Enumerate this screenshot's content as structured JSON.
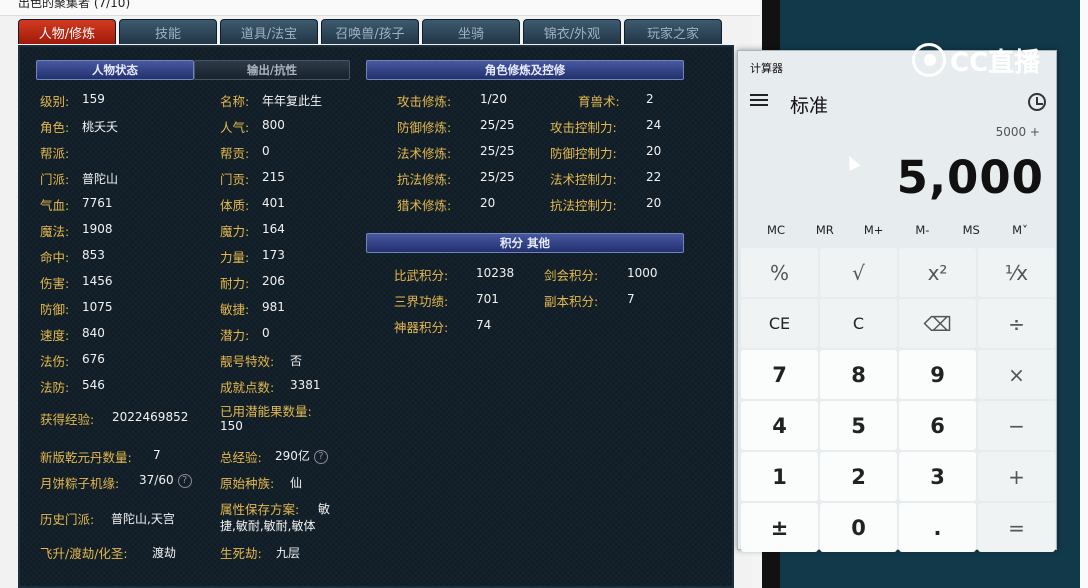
{
  "topbar_text": "出色的聚集者 (7/10)",
  "tabs": [
    "人物/修炼",
    "技能",
    "道具/法宝",
    "召唤兽/孩子",
    "坐骑",
    "锦衣/外观",
    "玩家之家"
  ],
  "panel_headers": {
    "char_status": "人物状态",
    "output_resist": "输出/抗性",
    "cultivation": "角色修炼及控修",
    "points": "积分 其他"
  },
  "left_stats": [
    {
      "label": "级别:",
      "value": "159"
    },
    {
      "label": "角色:",
      "value": "桃夭夭"
    },
    {
      "label": "帮派:",
      "value": ""
    },
    {
      "label": "门派:",
      "value": "普陀山"
    },
    {
      "label": "气血:",
      "value": "7761"
    },
    {
      "label": "魔法:",
      "value": "1908"
    },
    {
      "label": "命中:",
      "value": "853"
    },
    {
      "label": "伤害:",
      "value": "1456"
    },
    {
      "label": "防御:",
      "value": "1075"
    },
    {
      "label": "速度:",
      "value": "840"
    },
    {
      "label": "法伤:",
      "value": "676"
    },
    {
      "label": "法防:",
      "value": "546"
    }
  ],
  "right_stats": [
    {
      "label": "名称:",
      "value": "年年复此生"
    },
    {
      "label": "人气:",
      "value": "800"
    },
    {
      "label": "帮贡:",
      "value": "0"
    },
    {
      "label": "门贡:",
      "value": "215"
    },
    {
      "label": "体质:",
      "value": "401"
    },
    {
      "label": "魔力:",
      "value": "164"
    },
    {
      "label": "力量:",
      "value": "173"
    },
    {
      "label": "耐力:",
      "value": "206"
    },
    {
      "label": "敏捷:",
      "value": "981"
    },
    {
      "label": "潜力:",
      "value": "0"
    },
    {
      "label": "靓号特效:",
      "value": "否"
    },
    {
      "label": "成就点数:",
      "value": "3381"
    }
  ],
  "extra": {
    "exp_label": "获得经验:",
    "exp_value": "2022469852",
    "used_fruit_label": "已用潜能果数量:",
    "used_fruit_value": "150",
    "qianyuan_label": "新版乾元丹数量:",
    "qianyuan_value": "7",
    "total_exp_label": "总经验:",
    "total_exp_value": "290亿",
    "mooncake_label": "月饼粽子机缘:",
    "mooncake_value": "37/60",
    "race_label": "原始种族:",
    "race_value": "仙",
    "history_label": "历史门派:",
    "history_value": "普陀山,天宫",
    "attr_plan_label": "属性保存方案:",
    "attr_plan_value1": "敏",
    "attr_plan_value2": "捷,敏耐,敏耐,敏体",
    "ascend_label": "飞升/渡劫/化圣:",
    "ascend_value": "渡劫",
    "lifedeath_label": "生死劫:",
    "lifedeath_value": "九层"
  },
  "cultivation": [
    {
      "label": "攻击修炼:",
      "value": "1/20",
      "label2": "育兽术:",
      "value2": "2"
    },
    {
      "label": "防御修炼:",
      "value": "25/25",
      "label2": "攻击控制力:",
      "value2": "24"
    },
    {
      "label": "法术修炼:",
      "value": "25/25",
      "label2": "防御控制力:",
      "value2": "20"
    },
    {
      "label": "抗法修炼:",
      "value": "25/25",
      "label2": "法术控制力:",
      "value2": "22"
    },
    {
      "label": "猎术修炼:",
      "value": "20",
      "label2": "抗法控制力:",
      "value2": "20"
    }
  ],
  "points": [
    {
      "label": "比武积分:",
      "value": "10238",
      "label2": "剑会积分:",
      "value2": "1000"
    },
    {
      "label": "三界功绩:",
      "value": "701",
      "label2": "副本积分:",
      "value2": "7"
    },
    {
      "label": "神器积分:",
      "value": "74",
      "label2": "",
      "value2": ""
    }
  ],
  "calculator": {
    "title": "计算器",
    "mode": "标准",
    "expression": "5000 +",
    "display": "5,000",
    "memory": [
      "MC",
      "MR",
      "M+",
      "M-",
      "MS",
      "M˅"
    ],
    "keys": [
      "%",
      "√",
      "x²",
      "⅟x",
      "CE",
      "C",
      "⌫",
      "÷",
      "7",
      "8",
      "9",
      "×",
      "4",
      "5",
      "6",
      "−",
      "1",
      "2",
      "3",
      "+",
      "±",
      "0",
      ".",
      "="
    ]
  },
  "watermark": "CC直播"
}
